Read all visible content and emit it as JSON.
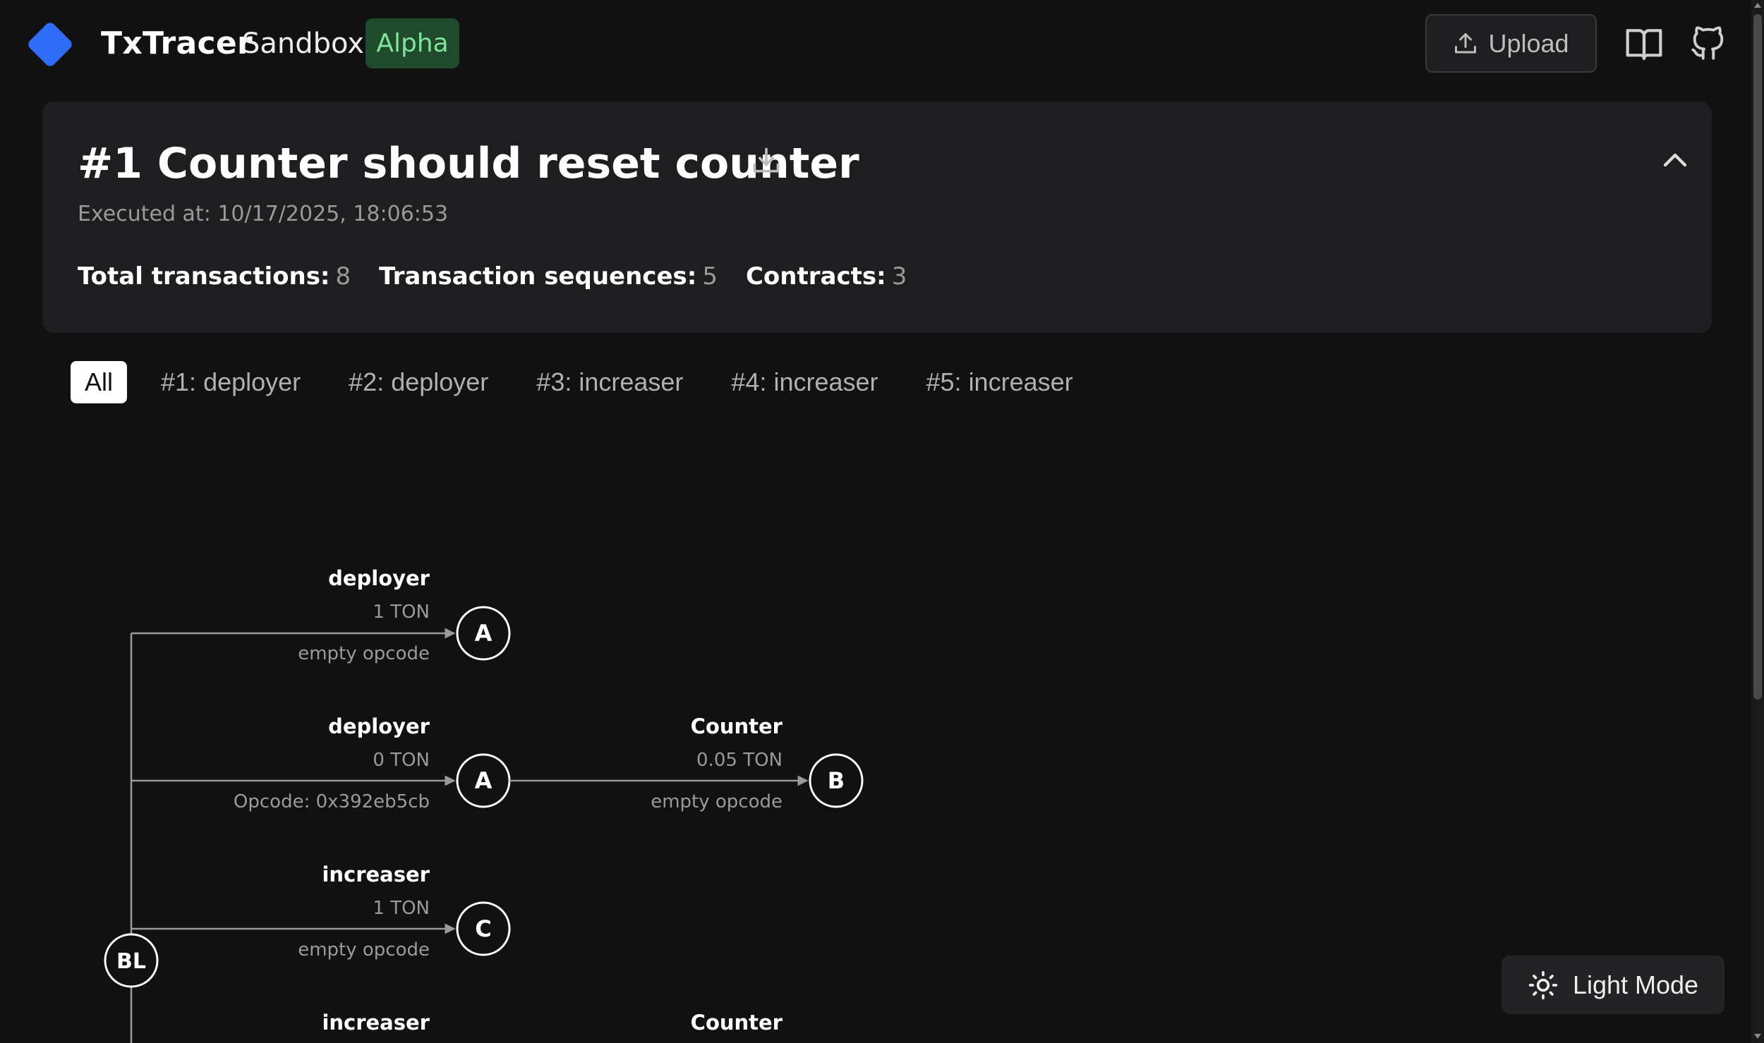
{
  "header": {
    "brand_name": "TxTracer",
    "brand_sub": "Sandbox",
    "badge": "Alpha",
    "upload_label": "Upload",
    "logo_icon": "diamond-logo-icon",
    "docs_icon": "book-icon",
    "github_icon": "github-icon",
    "colors": {
      "logo": "#2f6df6",
      "badge_bg": "#1f4a2c",
      "badge_text": "#7ee59a"
    }
  },
  "summary": {
    "title": "#1 Counter should reset counter",
    "executed_at": "Executed at: 10/17/2025, 18:06:53",
    "stats": [
      {
        "label": "Total transactions:",
        "value": "8"
      },
      {
        "label": "Transaction sequences:",
        "value": "5"
      },
      {
        "label": "Contracts:",
        "value": "3"
      }
    ]
  },
  "tabs": [
    {
      "label": "All",
      "active": true
    },
    {
      "label": "#1: deployer",
      "active": false
    },
    {
      "label": "#2: deployer",
      "active": false
    },
    {
      "label": "#3: increaser",
      "active": false
    },
    {
      "label": "#4: increaser",
      "active": false
    },
    {
      "label": "#5: increaser",
      "active": false
    }
  ],
  "graph": {
    "root": "BL",
    "rows": [
      {
        "edges": [
          {
            "from": "BL",
            "to": "A",
            "name": "deployer",
            "value": "1 TON",
            "opcode": "empty opcode"
          }
        ]
      },
      {
        "edges": [
          {
            "from": "BL",
            "to": "A",
            "name": "deployer",
            "value": "0 TON",
            "opcode": "Opcode: 0x392eb5cb"
          },
          {
            "from": "A",
            "to": "B",
            "name": "Counter",
            "value": "0.05 TON",
            "opcode": "empty opcode"
          }
        ]
      },
      {
        "edges": [
          {
            "from": "BL",
            "to": "C",
            "name": "increaser",
            "value": "1 TON",
            "opcode": "empty opcode"
          }
        ]
      },
      {
        "edges": [
          {
            "from": "BL",
            "to": "",
            "name": "increaser",
            "value": "",
            "opcode": ""
          },
          {
            "from": "",
            "to": "",
            "name": "Counter",
            "value": "",
            "opcode": ""
          }
        ]
      }
    ]
  },
  "theme_toggle": {
    "label": "Light Mode",
    "icon": "sun-icon"
  }
}
